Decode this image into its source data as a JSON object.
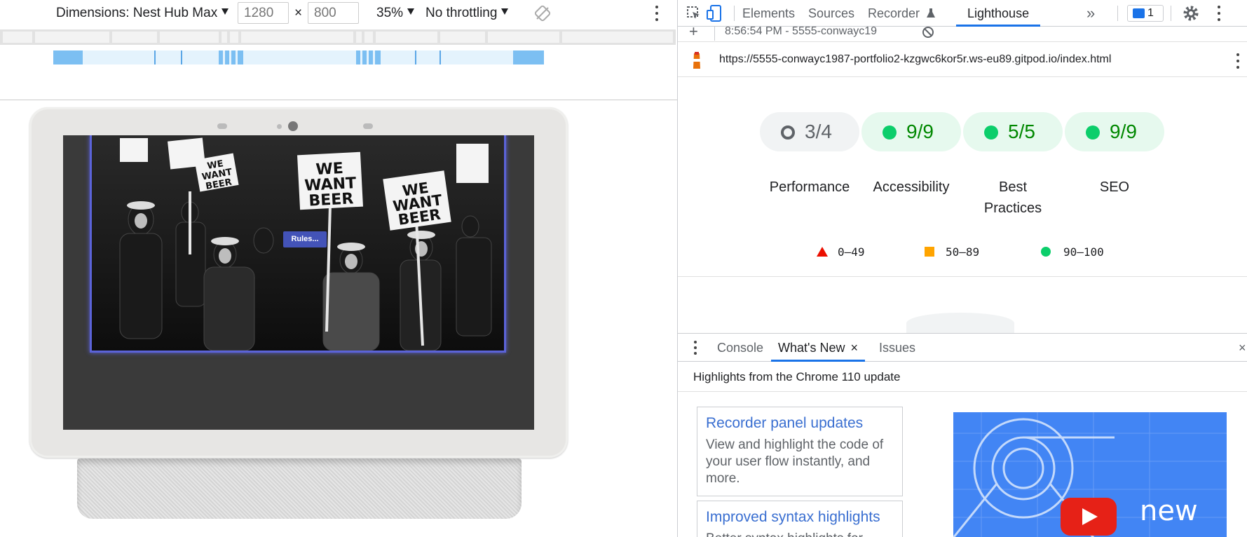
{
  "device_toolbar": {
    "dimensions_label": "Dimensions: Nest Hub Max",
    "width_value": "1280",
    "times_sign": "×",
    "height_value": "800",
    "zoom": "35%",
    "throttling": "No throttling"
  },
  "device_page": {
    "rules_button": "Rules...",
    "photo_signs": [
      "WE",
      "WANT",
      "BEER"
    ]
  },
  "devtools": {
    "tabs": [
      "Elements",
      "Sources",
      "Recorder",
      "Lighthouse"
    ],
    "more_tabs": "»",
    "issues_count": "1",
    "active_tab": "Lighthouse"
  },
  "lighthouse": {
    "report_time": "8:56:54 PM - 5555-conwayc19",
    "url": "https://5555-conwayc1987-portfolio2-kzgwc6kor5r.ws-eu89.gitpod.io/index.html",
    "scores": [
      {
        "label": "Performance",
        "value": "3/4",
        "status": "neutral"
      },
      {
        "label": "Accessibility",
        "value": "9/9",
        "status": "pass"
      },
      {
        "label": "Best Practices",
        "value": "5/5",
        "status": "pass"
      },
      {
        "label": "SEO",
        "value": "9/9",
        "status": "pass"
      }
    ],
    "legend": [
      {
        "range": "0–49",
        "shape": "triangle",
        "color": "#eb0f00"
      },
      {
        "range": "50–89",
        "shape": "square",
        "color": "#ffa400"
      },
      {
        "range": "90–100",
        "shape": "circle",
        "color": "#0cce6b"
      }
    ]
  },
  "drawer": {
    "tabs": [
      "Console",
      "What's New",
      "Issues"
    ],
    "active_tab": "What's New",
    "close_glyph": "×",
    "heading": "Highlights from the Chrome 110 update",
    "cards": [
      {
        "title": "Recorder panel updates",
        "description": "View and highlight the code of your user flow instantly, and more."
      },
      {
        "title": "Improved syntax highlights",
        "description": "Better syntax highlights for"
      }
    ],
    "video_label": "new"
  },
  "colors": {
    "accent": "#1a73e8",
    "pass": "#0cce6b",
    "pass_bg": "#e6f9ee",
    "neutral_bg": "#f1f3f4",
    "pass_text": "#008800"
  }
}
